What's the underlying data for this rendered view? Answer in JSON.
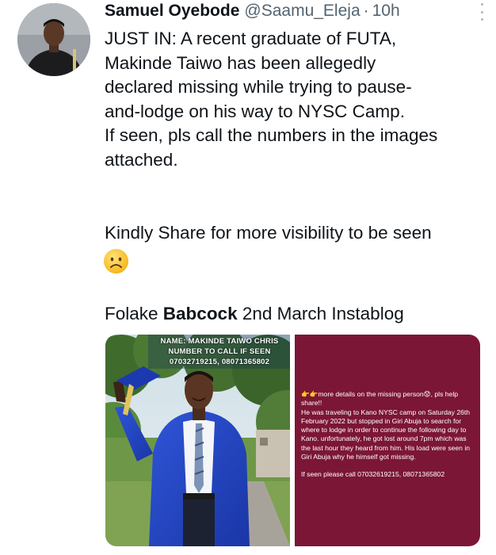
{
  "tweet": {
    "author_name": "Samuel Oyebode",
    "author_handle": "@Saamu_Eleja",
    "separator": "·",
    "timestamp": "10h",
    "body_lines": [
      "JUST IN: A recent graduate of FUTA,",
      "Makinde Taiwo has been allegedly",
      "declared missing while trying to pause-",
      "and-lodge on his way to NYSC Camp.",
      "If seen, pls call the numbers in the images",
      "attached."
    ],
    "share_line": "Kindly Share for more visibility to be seen",
    "emoji": "sad-face",
    "credit": {
      "prefix": "Folake ",
      "bold": "Babcock",
      "suffix": " 2nd March Instablog"
    }
  },
  "media": {
    "left_image": {
      "caption_lines": [
        "NAME: MAKINDE TAIWO CHRIS",
        "NUMBER TO CALL IF SEEN",
        "07032719215, 08071365802"
      ]
    },
    "right_image": {
      "intro": "👉👉more details on the missing person😟, pls help share!!",
      "body": "He was traveling to Kano NYSC camp on Saturday 26th February 2022 but stopped in Giri Abuja to search for where to lodge in order to continue the following day to Kano. unfortunately, he got lost around 7pm which was the last hour they heard from him. His load were seen in Giri Abuja why he himself got missing.",
      "call": "If seen please call 07032619215, 08071365802"
    }
  },
  "colors": {
    "text_primary": "#0f1419",
    "text_secondary": "#536471",
    "poster_background": "#7c1636",
    "gown_blue": "#1f3fb8"
  }
}
